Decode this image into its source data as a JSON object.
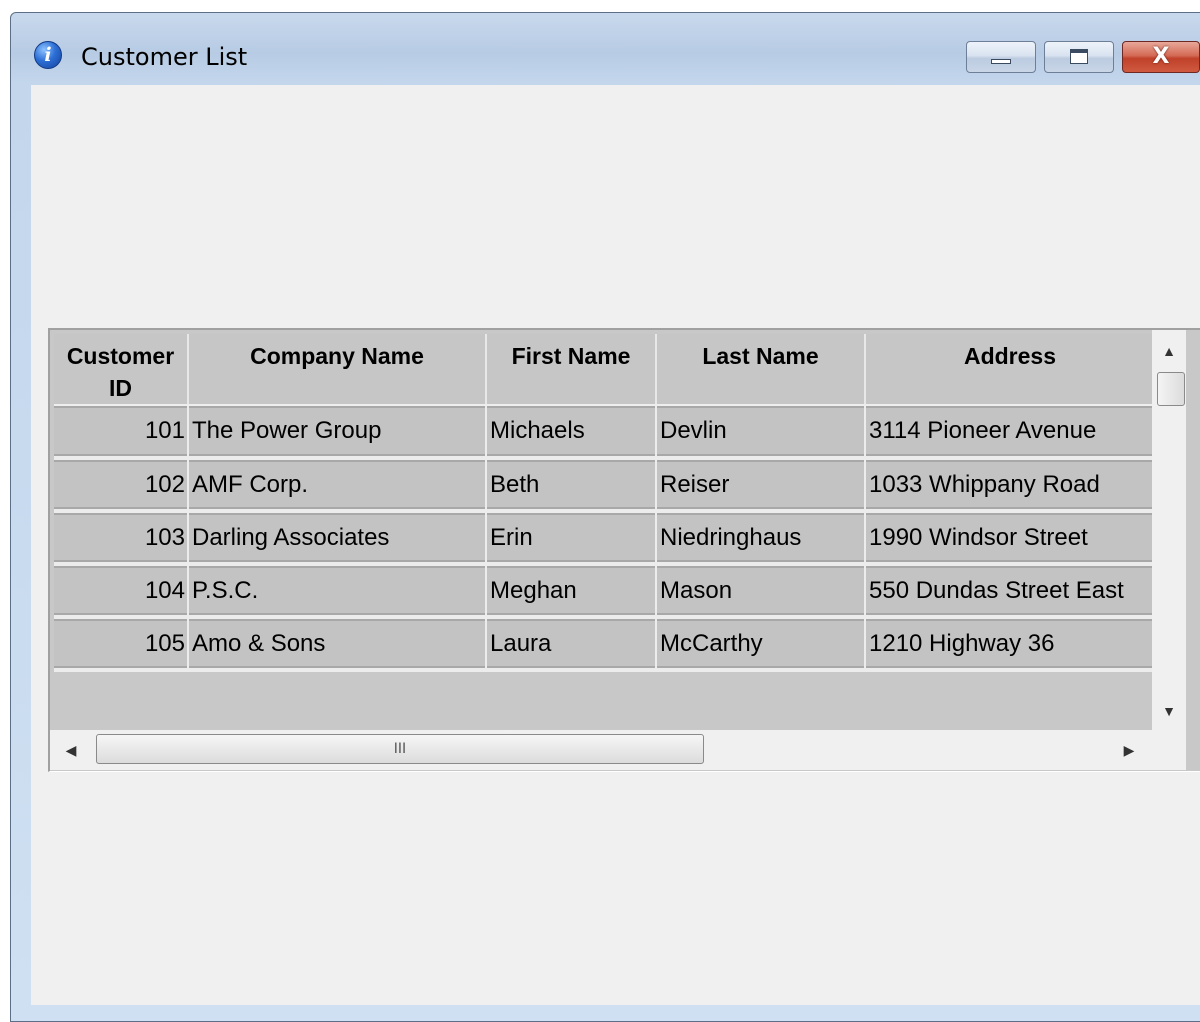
{
  "window": {
    "title": "Customer List",
    "icon": "info-icon",
    "controls": {
      "minimize_icon": "minimize-icon",
      "maximize_icon": "maximize-icon",
      "close_label": "X"
    }
  },
  "grid": {
    "columns": [
      "Customer ID",
      "Company Name",
      "First Name",
      "Last Name",
      "Address"
    ],
    "rows": [
      {
        "id": "101",
        "company": "The Power Group",
        "first": "Michaels",
        "last": "Devlin",
        "address": "3114 Pioneer Avenue"
      },
      {
        "id": "102",
        "company": "AMF Corp.",
        "first": "Beth",
        "last": "Reiser",
        "address": "1033 Whippany Road"
      },
      {
        "id": "103",
        "company": "Darling Associates",
        "first": "Erin",
        "last": "Niedringhaus",
        "address": "1990 Windsor Street"
      },
      {
        "id": "104",
        "company": "P.S.C.",
        "first": "Meghan",
        "last": "Mason",
        "address": "550 Dundas Street East"
      },
      {
        "id": "105",
        "company": "Amo & Sons",
        "first": "Laura",
        "last": "McCarthy",
        "address": "1210 Highway 36"
      }
    ],
    "hscroll_thumb_label": "III",
    "arrows": {
      "up": "▲",
      "down": "▼",
      "left": "◀",
      "right": "▶"
    }
  }
}
